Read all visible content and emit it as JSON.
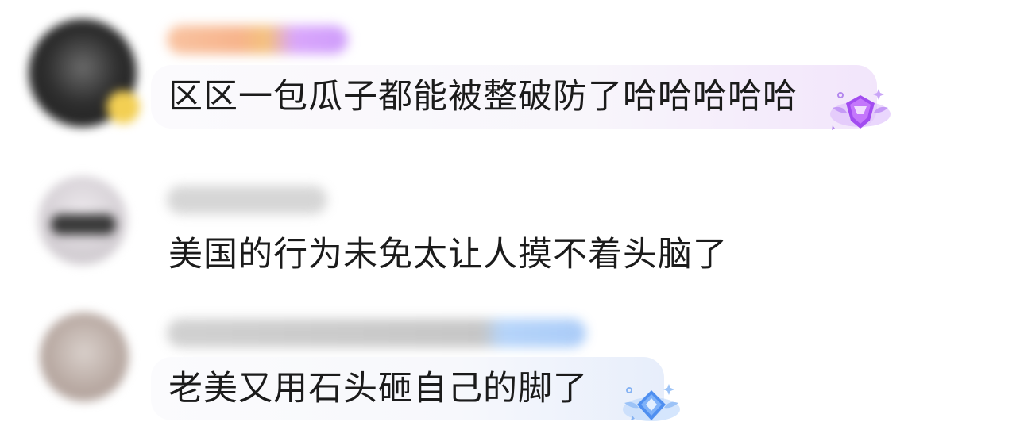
{
  "comments": [
    {
      "text": "区区一包瓜子都能被整破防了哈哈哈哈哈",
      "avatar_colors": [
        "#2e2e2e",
        "#f3cf53"
      ],
      "username_colors": [
        "#f7b48c",
        "#cf9dfb"
      ],
      "bubble_colors": [
        "#f8f6fb",
        "#f2e5fb"
      ],
      "badge_icon": "purple-diamond-gem-icon"
    },
    {
      "text": "美国的行为未免太让人摸不着头脑了",
      "avatar_colors": [
        "#d8d3d8",
        "#3a3a3a"
      ],
      "username_colors": [
        "#cfcfcf",
        "#bdbdbd"
      ],
      "bubble_colors": [],
      "badge_icon": ""
    },
    {
      "text": "老美又用石头砸自己的脚了",
      "avatar_colors": [
        "#b9aaa3",
        "#d9d0cb"
      ],
      "username_colors": [
        "#bdbdbd",
        "#9cc3f7"
      ],
      "bubble_colors": [
        "#f7f8fc",
        "#e7eefb"
      ],
      "badge_icon": "blue-diamond-gem-icon"
    }
  ]
}
